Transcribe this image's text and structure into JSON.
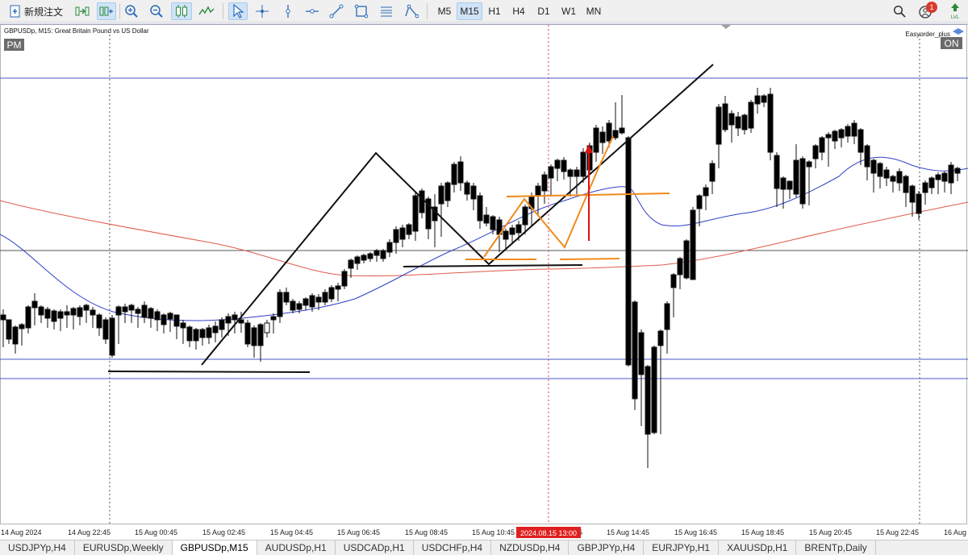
{
  "toolbar": {
    "new_order_label": "新規注文",
    "timeframes": [
      "M5",
      "M15",
      "H1",
      "H4",
      "D1",
      "W1",
      "MN"
    ],
    "active_timeframe": "M15",
    "notification_count": "1",
    "lvl_label": "LVL"
  },
  "chart": {
    "symbol_label": "GBPUSDp, M15:  Great Britain Pound vs US Dollar",
    "pm_label": "PM",
    "ea_name": "Easyorder_plus",
    "ea_status": "ON",
    "date_highlight": "2024.08.15 13:00",
    "time_labels": [
      "14 Aug 2024",
      "14 Aug 22:45",
      "15 Aug 00:45",
      "15 Aug 02:45",
      "15 Aug 04:45",
      "15 Aug 06:45",
      "15 Aug 08:45",
      "15 Aug 10:45",
      "15 Aug 12:45",
      "15 Aug 14:45",
      "15 Aug 16:45",
      "15 Aug 18:45",
      "15 Aug 20:45",
      "15 Aug 22:45",
      "16 Aug"
    ],
    "colors": {
      "bull_fill": "#ffffff",
      "bear_fill": "#000000",
      "ma_fast": "#3040c8",
      "ma_slow": "#e05a4a",
      "drawing_orange": "#f08a1c",
      "arrow_red": "#e01010",
      "hline": "#4a5ac8"
    }
  },
  "tabs": {
    "items": [
      "USDJPYp,H4",
      "EURUSDp,Weekly",
      "GBPUSDp,M15",
      "AUDUSDp,H1",
      "USDCADp,H1",
      "USDCHFp,H4",
      "NZDUSDp,H4",
      "GBPJPYp,H4",
      "EURJPYp,H1",
      "XAUUSDp,H1",
      "BRENTp,Daily"
    ],
    "active": "GBPUSDp,M15"
  }
}
